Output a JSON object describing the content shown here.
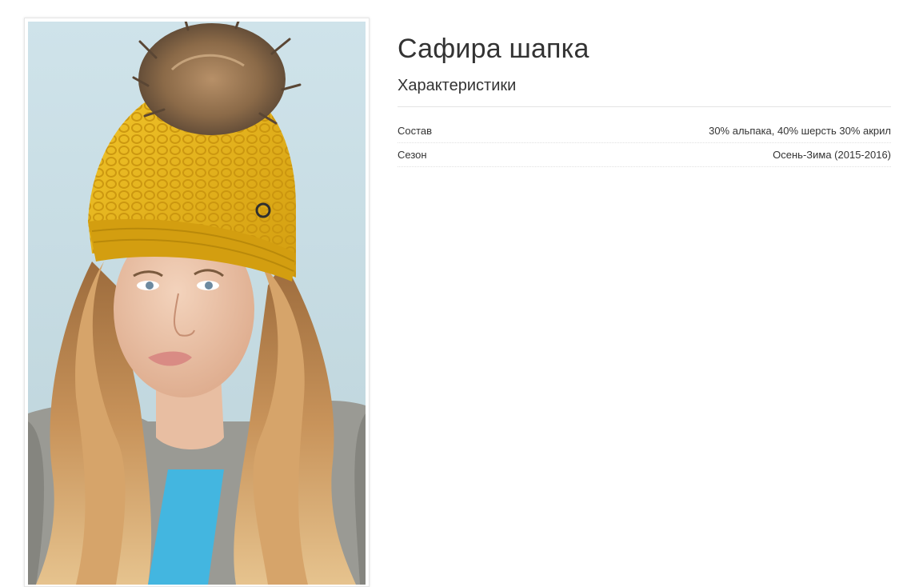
{
  "product": {
    "title": "Сафира шапка",
    "image_alt": "Женщина в жёлтой вязаной шапке с меховым помпоном"
  },
  "characteristics": {
    "heading": "Характеристики",
    "rows": [
      {
        "label": "Состав",
        "value": "30% альпака, 40% шерсть 30% акрил"
      },
      {
        "label": "Сезон",
        "value": "Осень-Зима (2015-2016)"
      }
    ]
  },
  "colors": {
    "hat": "#e7b41c",
    "background": "#c9dfe6",
    "sweater": "#9a9a94",
    "top": "#43b6e0",
    "hair": "#c8935a",
    "pompom": "#8b6a48"
  }
}
